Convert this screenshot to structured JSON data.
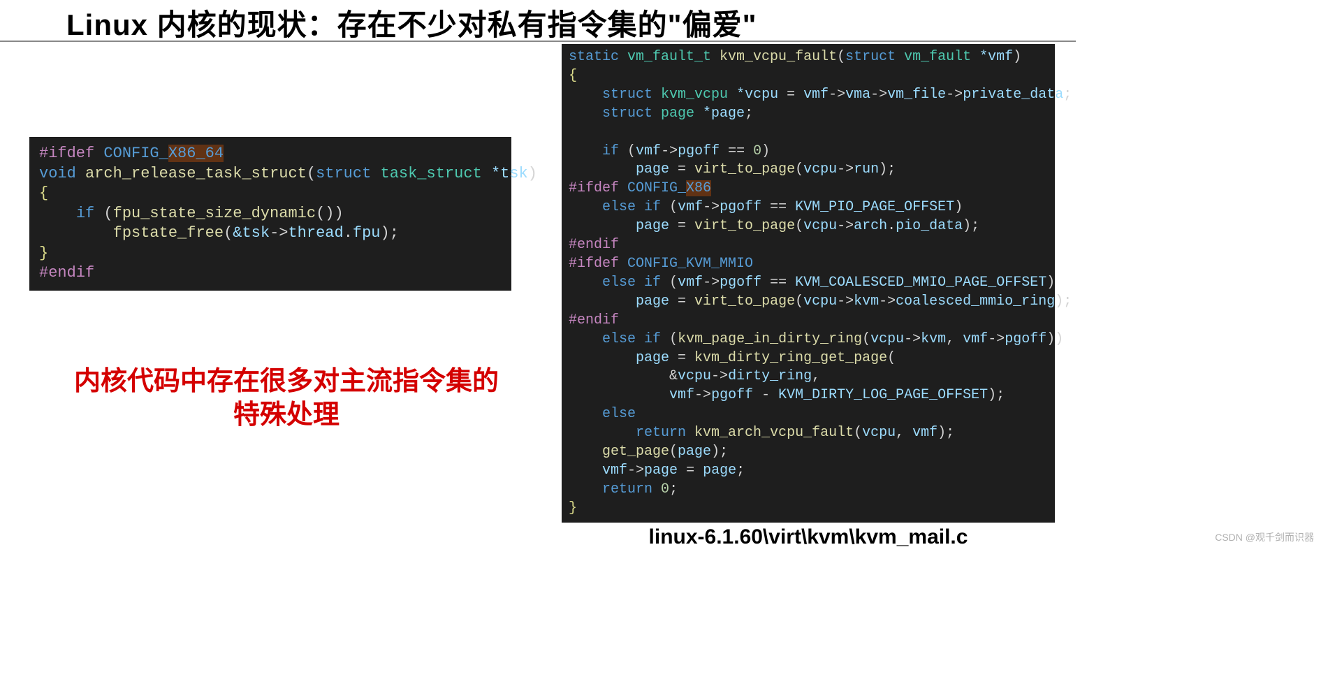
{
  "title": "Linux 内核的现状：存在不少对私有指令集的\"偏爱\"",
  "callout_line1": "内核代码中存在很多对主流指令集的",
  "callout_line2": "特殊处理",
  "filepath": "linux-6.1.60\\virt\\kvm\\kvm_mail.c",
  "watermark": "CSDN @观千剑而识器",
  "left_code": {
    "l1_ifdef": "#ifdef",
    "l1_config": " CONFIG_",
    "l1_x86": "X86_64",
    "l2_void": "void",
    "l2_fn": " arch_release_task_struct",
    "l2_struct": "struct",
    "l2_type": " task_struct ",
    "l2_param": "*tsk",
    "l3_brace": "{",
    "l4_if": "if",
    "l4_fn": "fpu_state_size_dynamic",
    "l5_fn": "fpstate_free",
    "l5_arg1": "&tsk",
    "l5_arg2": "thread",
    "l5_arg3": "fpu",
    "l6_brace": "}",
    "l7_endif": "#endif"
  },
  "right_code": {
    "l1_static": "static",
    "l1_type": " vm_fault_t ",
    "l1_fn": "kvm_vcpu_fault",
    "l1_struct": "struct",
    "l1_ptype": " vm_fault ",
    "l1_param": "*vmf",
    "l2_brace": "{",
    "l3_struct": "struct",
    "l3_type": " kvm_vcpu ",
    "l3_var": "*vcpu",
    "l3_vmf": "vmf",
    "l3_vma": "vma",
    "l3_vmfile": "vm_file",
    "l3_priv": "private_data",
    "l4_struct": "struct",
    "l4_type": " page ",
    "l4_var": "*page",
    "l6_if": "if",
    "l6_vmf": "vmf",
    "l6_pgoff": "pgoff",
    "l6_zero": "0",
    "l7_page": "page",
    "l7_fn": "virt_to_page",
    "l7_vcpu": "vcpu",
    "l7_run": "run",
    "l8_ifdef": "#ifdef",
    "l8_config": " CONFIG_",
    "l8_x86": "X86",
    "l9_else": "else",
    "l9_if": "if",
    "l9_vmf": "vmf",
    "l9_pgoff": "pgoff",
    "l9_const": "KVM_PIO_PAGE_OFFSET",
    "l10_page": "page",
    "l10_fn": "virt_to_page",
    "l10_vcpu": "vcpu",
    "l10_arch": "arch",
    "l10_pio": "pio_data",
    "l11_endif": "#endif",
    "l12_ifdef": "#ifdef",
    "l12_config": " CONFIG_KVM_MMIO",
    "l13_else": "else",
    "l13_if": "if",
    "l13_vmf": "vmf",
    "l13_pgoff": "pgoff",
    "l13_const": "KVM_COALESCED_MMIO_PAGE_OFFSET",
    "l14_page": "page",
    "l14_fn": "virt_to_page",
    "l14_vcpu": "vcpu",
    "l14_kvm": "kvm",
    "l14_ring": "coalesced_mmio_ring",
    "l15_endif": "#endif",
    "l16_else": "else",
    "l16_if": "if",
    "l16_fn": "kvm_page_in_dirty_ring",
    "l16_vcpu": "vcpu",
    "l16_kvm": "kvm",
    "l16_vmf": "vmf",
    "l16_pgoff": "pgoff",
    "l17_page": "page",
    "l17_fn": "kvm_dirty_ring_get_page",
    "l18_vcpu": "vcpu",
    "l18_dr": "dirty_ring",
    "l19_vmf": "vmf",
    "l19_pgoff": "pgoff",
    "l19_const": "KVM_DIRTY_LOG_PAGE_OFFSET",
    "l20_else": "else",
    "l21_return": "return",
    "l21_fn": "kvm_arch_vcpu_fault",
    "l21_vcpu": "vcpu",
    "l21_vmf": "vmf",
    "l22_fn": "get_page",
    "l22_page": "page",
    "l23_vmf": "vmf",
    "l23_page1": "page",
    "l23_page2": "page",
    "l24_return": "return",
    "l24_zero": "0",
    "l25_brace": "}"
  }
}
